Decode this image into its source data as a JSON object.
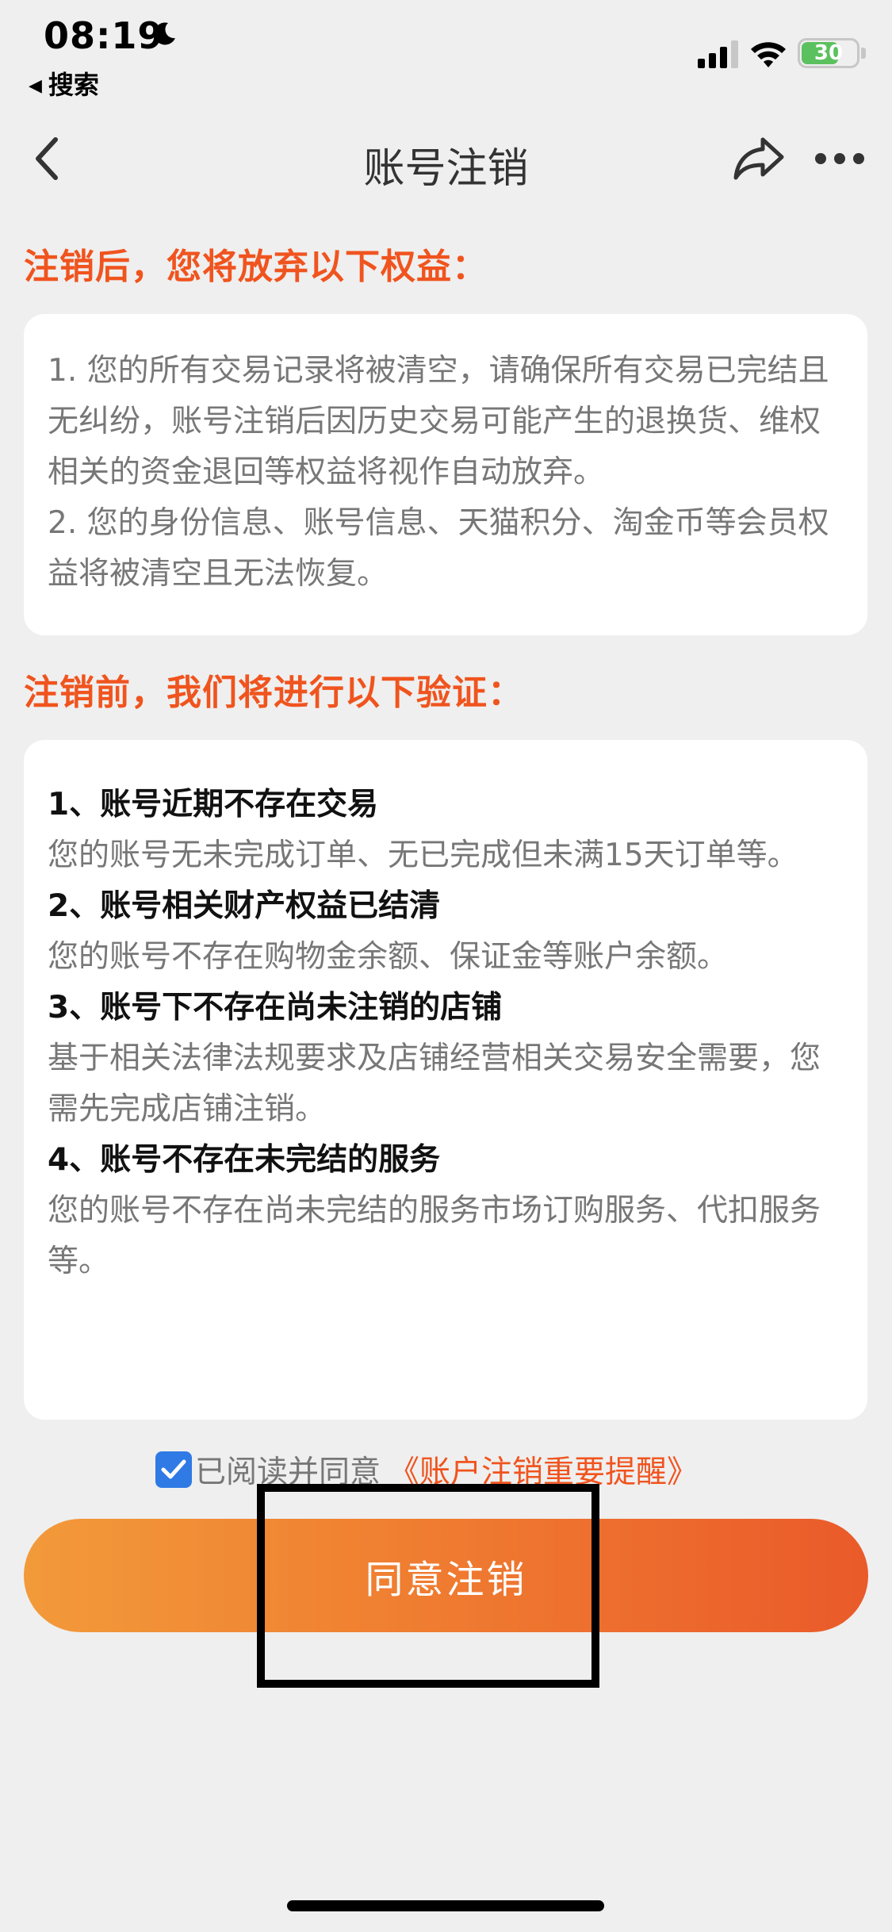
{
  "status_bar": {
    "time": "08:19",
    "back_app": "搜索",
    "battery": "30"
  },
  "nav": {
    "title": "账号注销"
  },
  "section1": {
    "heading": "注销后，您将放弃以下权益：",
    "paragraphs": [
      "1. 您的所有交易记录将被清空，请确保所有交易已完结且无纠纷，账号注销后因历史交易可能产生的退换货、维权相关的资金退回等权益将视作自动放弃。",
      "2. 您的身份信息、账号信息、天猫积分、淘金币等会员权益将被清空且无法恢复。"
    ]
  },
  "section2": {
    "heading": "注销前，我们将进行以下验证：",
    "items": [
      {
        "title": "1、账号近期不存在交易",
        "desc": "您的账号无未完成订单、无已完成但未满15天订单等。"
      },
      {
        "title": "2、账号相关财产权益已结清",
        "desc": "您的账号不存在购物金余额、保证金等账户余额。"
      },
      {
        "title": "3、账号下不存在尚未注销的店铺",
        "desc": "基于相关法律法规要求及店铺经营相关交易安全需要，您需先完成店铺注销。"
      },
      {
        "title": "4、账号不存在未完结的服务",
        "desc": "您的账号不存在尚未完结的服务市场订购服务、代扣服务等。"
      }
    ]
  },
  "agreement": {
    "checked": true,
    "text": "已阅读并同意",
    "link": "《账户注销重要提醒》"
  },
  "confirm_button": "同意注销",
  "colors": {
    "accent": "#f0541e",
    "button_start": "#f29a3a",
    "button_end": "#ea5a2a",
    "checkbox": "#2f7ae5",
    "background": "#efefef"
  }
}
